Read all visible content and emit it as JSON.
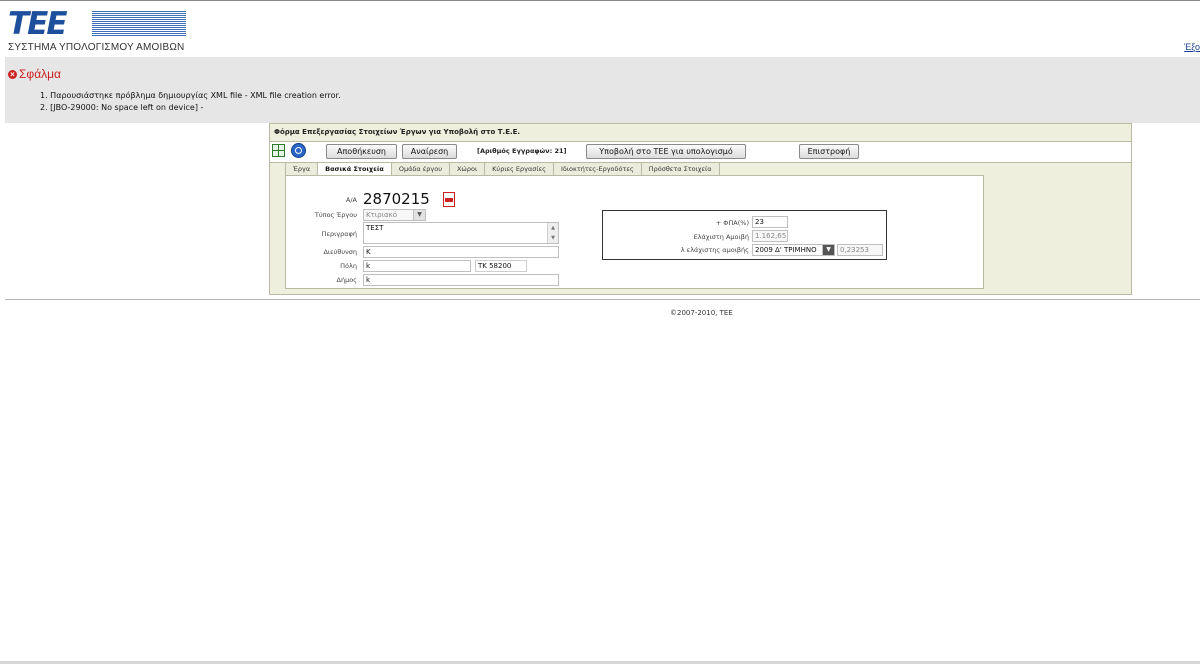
{
  "header": {
    "logo_letters": "ΤΕΕ",
    "logo_subtitle": "ΣΥΣΤΗΜΑ ΥΠΟΛΟΓΙΣΜΟΥ ΑΜΟΙΒΩΝ",
    "exit_link": "Έξο"
  },
  "error": {
    "title": "Σφάλμα",
    "items": [
      "1.  Παρουσιάστηκε πρόβλημα δημιουργίας XML file - XML file creation error.",
      "2.  [JBO-29000: No space left on device] -"
    ]
  },
  "form": {
    "title": "Φόρμα Επεξεργασίας Στοιχείων Έργων για Υποβολή στο Τ.Ε.Ε.",
    "toolbar": {
      "save": "Αποθήκευση",
      "undo": "Αναίρεση",
      "record_count": "[Αριθμός Εγγραφών: 21]",
      "submit": "Υποβολή στο ΤΕΕ για υπολογισμό",
      "back": "Επιστροφή"
    },
    "tabs": [
      "Έργα",
      "Βασικά Στοιχεία",
      "Ομάδα έργου",
      "Χώροι",
      "Κύριες Εργασίες",
      "Ιδιοκτήτες-Εργοδότες",
      "Πρόσθετα Στοιχεία"
    ],
    "active_tab": "Βασικά Στοιχεία",
    "fields": {
      "aa_label": "Α/Α",
      "aa_value": "2870215",
      "type_label": "Τύπος Έργου",
      "type_value": "Κτιριακό",
      "description_label": "Περιγραφή",
      "description_value": "ΤΕΣΤ",
      "address_label": "Διεύθυνση",
      "address_value": "Κ",
      "city_label": "Πόλη",
      "city_value": "k",
      "zip_value": "ΤΚ 58200",
      "municipality_label": "Δήμος",
      "municipality_value": "k"
    },
    "fee_box": {
      "vat_label": "+ ΦΠΑ(%)",
      "vat_value": "23",
      "min_fee_label": "Ελάχιστη Αμοιβή",
      "min_fee_value": "1.162,65",
      "lambda_label": "λ ελάχιστης αμοιβής",
      "lambda_period": "2009 Δ' ΤΡΙΜΗΝΟ",
      "lambda_value": "0,23253"
    }
  },
  "footer": {
    "copyright": "©2007-2010, ΤΕΕ"
  }
}
